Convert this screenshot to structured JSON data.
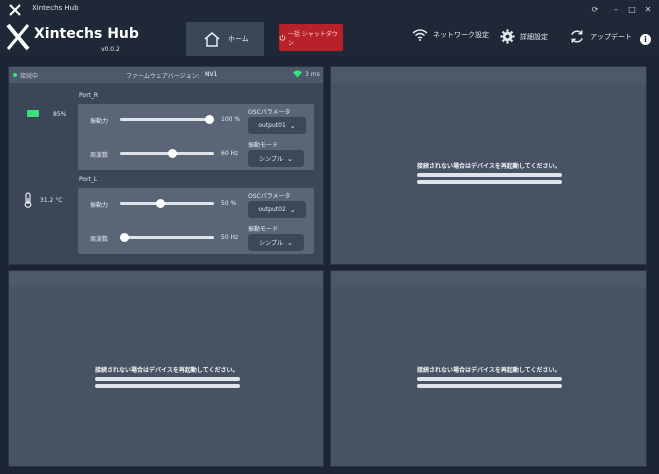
{
  "titlebar": {
    "title": "Xintechs Hub"
  },
  "header": {
    "brand": "Xintechs Hub",
    "version": "v0.0.2",
    "home_label": "ホーム",
    "shutdown_label": "一括 シャットダウン",
    "network_label": "ネットワーク設定",
    "settings_label": "詳細設定",
    "update_label": "アップデート",
    "info_glyph": "i"
  },
  "device": {
    "status": "接続中",
    "firmware_label": "ファームウェアバージョン:",
    "firmware_value": "NV1",
    "latency": "3 ms",
    "battery": "85%",
    "temperature": "31.2 °C",
    "ports": [
      {
        "name": "Port_R",
        "strength_label": "振動力",
        "strength_value": "100 %",
        "strength_level": 1.0,
        "freq_label": "周波数",
        "freq_value": "60 Hz",
        "freq_level": 0.57,
        "osc_label": "OSCパラメータ",
        "osc_value": "output01",
        "mode_label": "振動モード",
        "mode_value": "シンプル"
      },
      {
        "name": "Port_L",
        "strength_label": "振動力",
        "strength_value": "50 %",
        "strength_level": 0.42,
        "freq_label": "周波数",
        "freq_value": "50 Hz",
        "freq_level": 0.0,
        "osc_label": "OSCパラメータ",
        "osc_value": "output02",
        "mode_label": "振動モード",
        "mode_value": "シンプル"
      }
    ]
  },
  "empty_slots": {
    "message": "接続されない場合はデバイスを再起動してください。"
  },
  "colors": {
    "accent_green": "#37e27a",
    "shutdown_red": "#b8212a",
    "panel": "#3b4758",
    "header": "#1f2836"
  }
}
